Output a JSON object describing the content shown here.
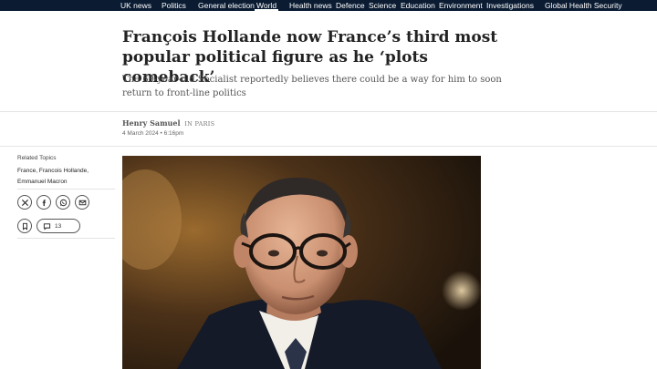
{
  "nav": {
    "items": [
      {
        "label": "UK news",
        "active": false
      },
      {
        "label": "Politics",
        "active": false
      },
      {
        "label": "General election",
        "active": false
      },
      {
        "label": "World",
        "active": true
      },
      {
        "label": "Health news",
        "active": false
      },
      {
        "label": "Defence",
        "active": false
      },
      {
        "label": "Science",
        "active": false
      },
      {
        "label": "Education",
        "active": false
      },
      {
        "label": "Environment",
        "active": false
      },
      {
        "label": "Investigations",
        "active": false
      },
      {
        "label": "Global Health Security",
        "active": false
      }
    ]
  },
  "article": {
    "headline": "François Hollande now France’s third most popular political figure as he ‘plots comeback’",
    "standfirst": "The 69-year-old Socialist reportedly believes there could be a way for him to soon return to front-line politics",
    "author": "Henry Samuel",
    "location": "IN PARIS",
    "date": "4 March 2024 • 6:16pm"
  },
  "sidebar": {
    "related_title": "Related Topics",
    "topics": [
      "France",
      "Francois Hollande",
      "Emmanuel Macron"
    ],
    "share_icons": [
      "x-icon",
      "facebook-icon",
      "whatsapp-icon",
      "email-icon"
    ],
    "comment_count": "13"
  },
  "colors": {
    "nav_bg": "#0a1b32",
    "text": "#121212"
  }
}
